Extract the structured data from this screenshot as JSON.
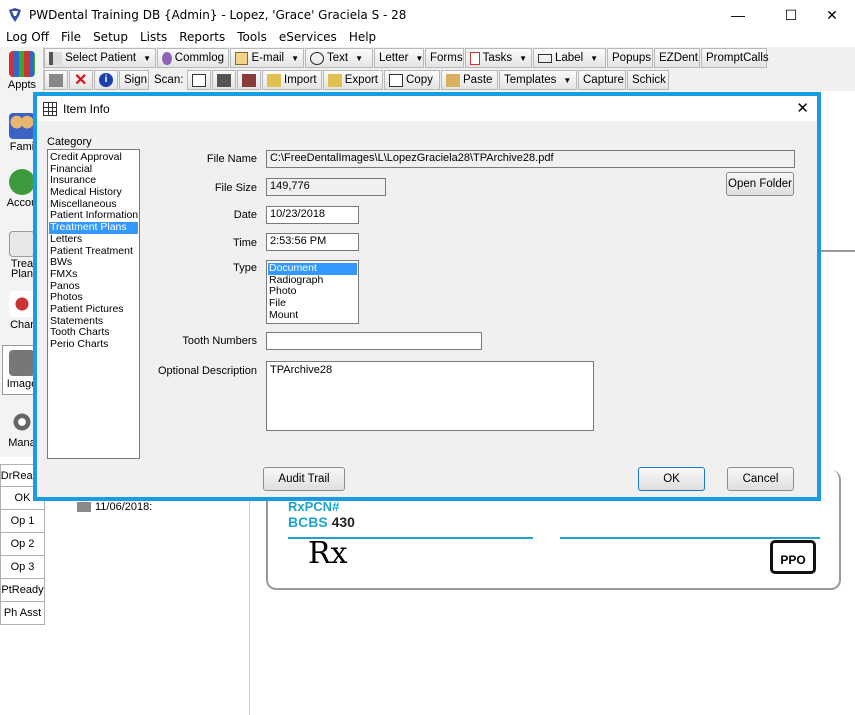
{
  "window": {
    "title": "PWDental Training DB {Admin} - Lopez, 'Grace' Graciela S - 28",
    "minimize": "—",
    "maximize": "☐",
    "close": "✕"
  },
  "menu": [
    "Log Off",
    "File",
    "Setup",
    "Lists",
    "Reports",
    "Tools",
    "eServices",
    "Help"
  ],
  "toolbar1": [
    {
      "label": "Select Patient",
      "icon": "select-patient-icon",
      "dropdown": true
    },
    {
      "label": "Commlog",
      "icon": "commlog-icon",
      "dropdown": false
    },
    {
      "label": "E-mail",
      "icon": "email-icon",
      "dropdown": true
    },
    {
      "label": "Text",
      "icon": "text-bubble-icon",
      "dropdown": true
    },
    {
      "label": "Letter",
      "icon": "",
      "dropdown": true
    },
    {
      "label": "Forms",
      "icon": "",
      "dropdown": false
    },
    {
      "label": "Tasks",
      "icon": "tasks-icon",
      "dropdown": true
    },
    {
      "label": "Label",
      "icon": "label-icon",
      "dropdown": true
    },
    {
      "label": "Popups",
      "icon": "",
      "dropdown": false
    },
    {
      "label": "EZDent",
      "icon": "",
      "dropdown": false
    },
    {
      "label": "PromptCalls",
      "icon": "",
      "dropdown": false
    }
  ],
  "toolbar2": {
    "sign_label": "Sign",
    "scan_label": "Scan:",
    "import_label": "Import",
    "export_label": "Export",
    "copy_label": "Copy",
    "paste_label": "Paste",
    "templates_label": "Templates",
    "capture_label": "Capture",
    "schick_label": "Schick"
  },
  "modules": [
    {
      "label": "Appts",
      "icon": "appointments-icon",
      "selected": false
    },
    {
      "label": "Fami",
      "icon": "family-icon",
      "selected": false
    },
    {
      "label": "Accou",
      "icon": "account-icon",
      "selected": false
    },
    {
      "label": "Trea Plan",
      "icon": "treatment-plan-icon",
      "selected": false
    },
    {
      "label": "Char",
      "icon": "chart-icon",
      "selected": false
    },
    {
      "label": "Image",
      "icon": "imaging-icon",
      "selected": true
    },
    {
      "label": "Mana",
      "icon": "manage-icon",
      "selected": false
    }
  ],
  "operatories": [
    "DrReady",
    "OK",
    "Op 1",
    "Op 2",
    "Op 3",
    "PtReady",
    "Ph Asst"
  ],
  "background": {
    "tree_item": "11/06/2018:",
    "card_rxpcn": "RxPCN#",
    "card_bcbs": "BCBS",
    "card_bcbs_num": "430",
    "card_rx": "Rx",
    "card_ppo": "PPO"
  },
  "dialog": {
    "title": "Item Info",
    "category_label": "Category",
    "categories": [
      "Credit Approval",
      "Financial",
      "Insurance",
      "Medical History",
      "Miscellaneous",
      "Patient Information",
      "Treatment Plans",
      "Letters",
      "Patient Treatment",
      "BWs",
      "FMXs",
      "Panos",
      "Photos",
      "Patient Pictures",
      "Statements",
      "Tooth Charts",
      "Perio Charts"
    ],
    "selected_category": "Treatment Plans",
    "file_name_label": "File Name",
    "file_name": "C:\\FreeDentalImages\\L\\LopezGraciela28\\TPArchive28.pdf",
    "file_size_label": "File Size",
    "file_size": "149,776",
    "date_label": "Date",
    "date": "10/23/2018",
    "time_label": "Time",
    "time": "2:53:56 PM",
    "type_label": "Type",
    "types": [
      "Document",
      "Radiograph",
      "Photo",
      "File",
      "Mount"
    ],
    "selected_type": "Document",
    "tooth_numbers_label": "Tooth Numbers",
    "tooth_numbers": "",
    "description_label": "Optional Description",
    "description": "TPArchive28",
    "open_folder_label": "Open Folder",
    "audit_trail_label": "Audit Trail",
    "ok_label": "OK",
    "cancel_label": "Cancel",
    "border_color": "#1a9be6",
    "selection_color": "#3399ff"
  }
}
